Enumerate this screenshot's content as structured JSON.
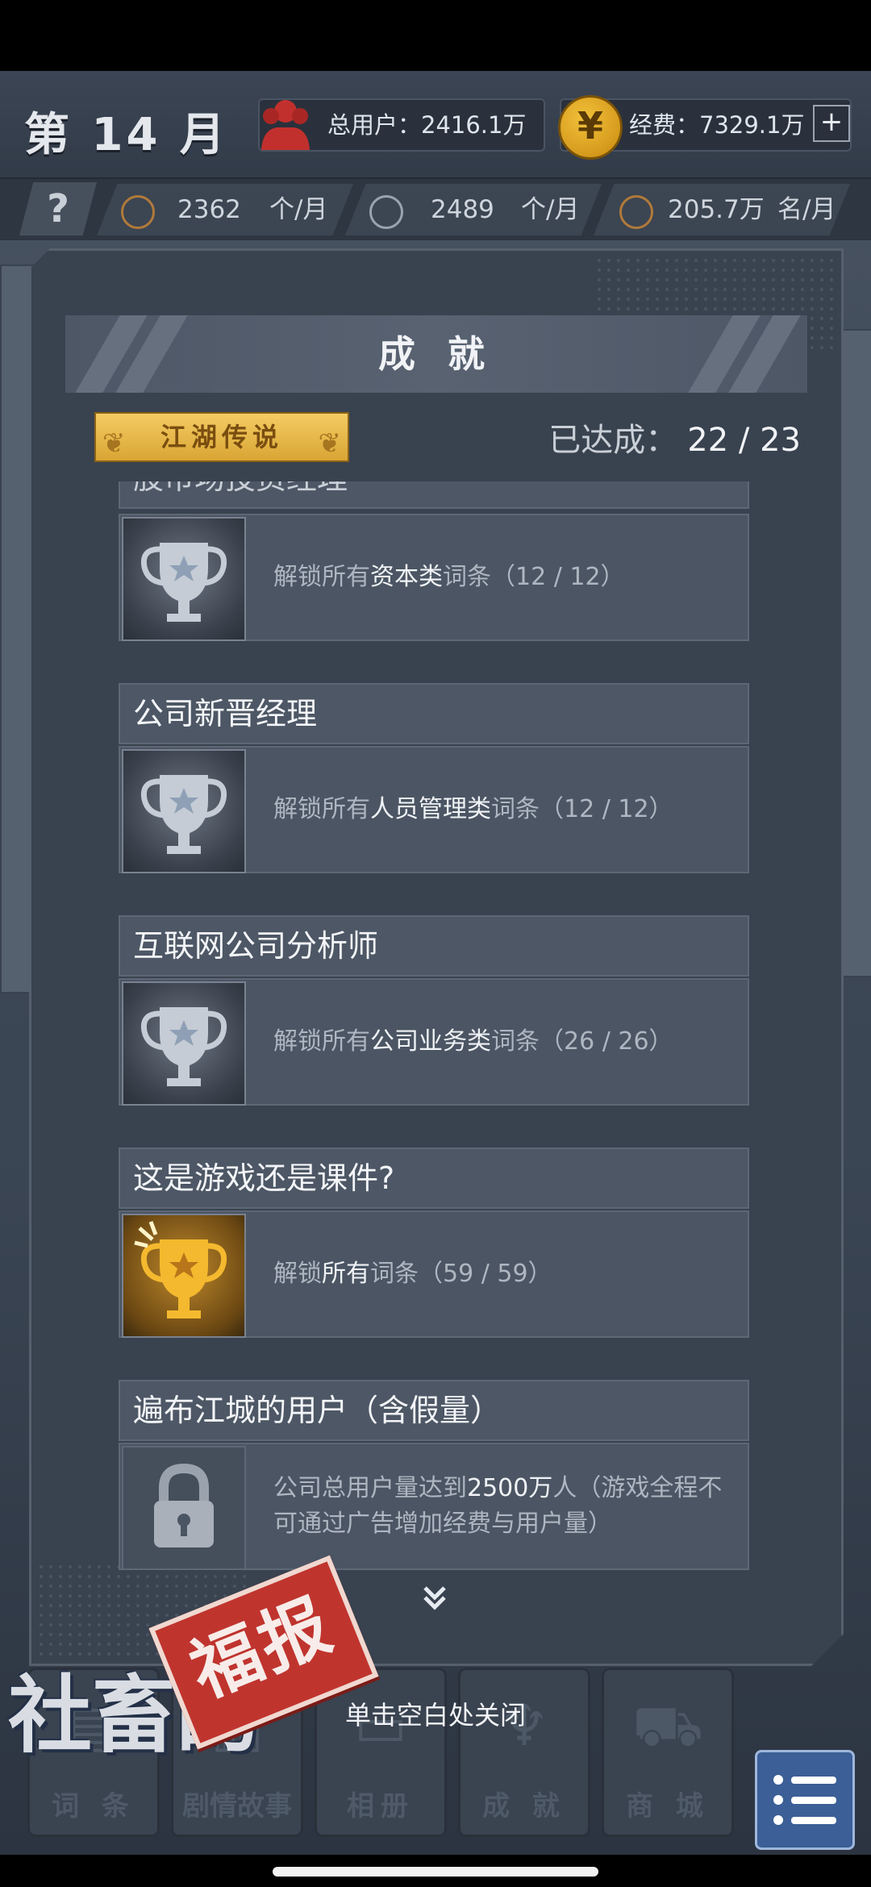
{
  "hud": {
    "month": "第 14 月",
    "total_users": "总用户：2416.1万",
    "funds": "经费：7329.1万",
    "plus": "+",
    "help": "?"
  },
  "stats": [
    {
      "icon": "lightbulb-icon",
      "value": "2362",
      "unit": "个/月"
    },
    {
      "icon": "wrench-icon",
      "value": "2489",
      "unit": "个/月"
    },
    {
      "icon": "person-icon",
      "value": "205.7万",
      "unit": "名/月"
    }
  ],
  "panel": {
    "title": "成 就",
    "badge": "江湖传说",
    "achieved_label": "已达成：",
    "achieved_count": "22 / 23",
    "partial_title": "股市场投资经理"
  },
  "achievements": [
    {
      "title": "",
      "desc_pre": "解锁所有",
      "desc_bold": "资本类",
      "desc_post": "词条（12 / 12）",
      "icon": "trophy-silver-icon",
      "state": "silver"
    },
    {
      "title": "公司新晋经理",
      "desc_pre": "解锁所有",
      "desc_bold": "人员管理类",
      "desc_post": "词条（12 / 12）",
      "icon": "trophy-silver-icon",
      "state": "silver"
    },
    {
      "title": "互联网公司分析师",
      "desc_pre": "解锁所有",
      "desc_bold": "公司业务类",
      "desc_post": "词条（26 / 26）",
      "icon": "trophy-silver-icon",
      "state": "silver"
    },
    {
      "title": "这是游戏还是课件?",
      "desc_pre": "解锁",
      "desc_bold": "所有",
      "desc_post": "词条（59 / 59）",
      "icon": "trophy-gold-icon",
      "state": "gold"
    },
    {
      "title": "遍布江城的用户（含假量）",
      "desc_pre": "公司总用户量达到",
      "desc_bold": "2500万",
      "desc_post": "人（游戏全程不可通过广告增加经费与用户量）",
      "icon": "lock-icon",
      "state": "locked"
    }
  ],
  "nav": [
    {
      "label": "词 条",
      "icon": "book-icon"
    },
    {
      "label": "剧情故事",
      "icon": "story-icon"
    },
    {
      "label": "相册",
      "icon": "album-icon"
    },
    {
      "label": "成 就",
      "icon": "trophy-icon"
    },
    {
      "label": "商 城",
      "icon": "cart-icon"
    }
  ],
  "close_hint": "单击空白处关闭",
  "logo": {
    "main": "社畜的",
    "stamp": "福报"
  },
  "more_arrow": "⌄"
}
